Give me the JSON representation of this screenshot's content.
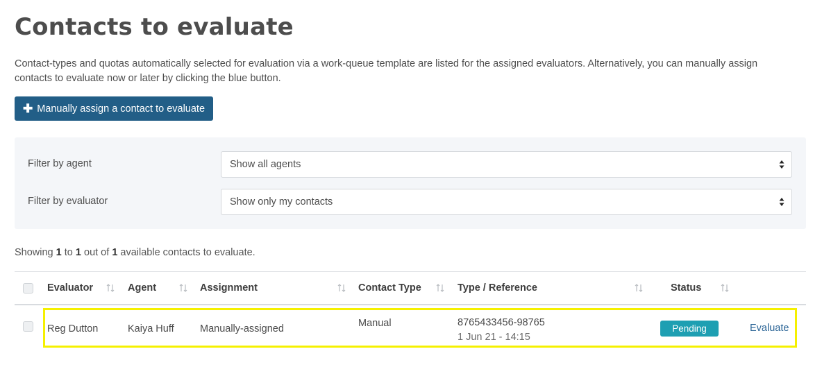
{
  "page": {
    "title": "Contacts to evaluate",
    "intro": "Contact-types and quotas automatically selected for evaluation via a work-queue template are listed for the assigned evaluators. Alternatively, you can manually assign contacts to evaluate now or later by clicking the blue button."
  },
  "assign_button": {
    "icon": "plus-icon",
    "label": "Manually assign a contact to evaluate",
    "color": "#225e87"
  },
  "filters": [
    {
      "label": "Filter by agent",
      "selected": "Show all agents"
    },
    {
      "label": "Filter by evaluator",
      "selected": "Show only my contacts"
    }
  ],
  "summary": {
    "prefix": "Showing",
    "from": "1",
    "to_word": "to",
    "to": "1",
    "out_of_word": "out of",
    "total": "1",
    "suffix": "available contacts to evaluate."
  },
  "table": {
    "columns": [
      "Evaluator",
      "Agent",
      "Assignment",
      "Contact Type",
      "Type / Reference",
      "Status"
    ],
    "rows": [
      {
        "evaluator": "Reg Dutton",
        "agent": "Kaiya Huff",
        "assignment": "Manually-assigned",
        "contact_type": "Manual",
        "reference": "8765433456-98765",
        "date": "1 Jun 21 - 14:15",
        "status": "Pending",
        "action": "Evaluate"
      }
    ]
  },
  "colors": {
    "status_pending": "#1e9fb2",
    "highlight": "#f5f000",
    "link": "#2a6496"
  }
}
